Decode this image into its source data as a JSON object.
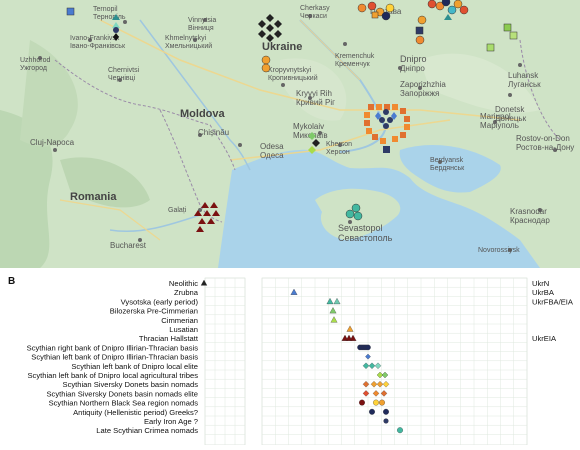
{
  "map": {
    "city_labels": [
      {
        "name": "Ternopil",
        "alt": "Тернопіль"
      },
      {
        "name": "Vinnytsia",
        "alt": "Вінниця"
      },
      {
        "name": "Cherkasy",
        "alt": "Черкаси"
      },
      {
        "name": "Ivano-Frankivsk",
        "alt": "Івано-Франківськ"
      },
      {
        "name": "Khmelnytskyi",
        "alt": "Хмельницький"
      },
      {
        "name": "Ukraine",
        "alt": ""
      },
      {
        "name": "Kremenchuk",
        "alt": "Кременчук"
      },
      {
        "name": "Dnipro",
        "alt": "Дніпро"
      },
      {
        "name": "Luhansk",
        "alt": "Луганськ"
      },
      {
        "name": "Uzhhorod",
        "alt": "Ужгород"
      },
      {
        "name": "Chernivtsi",
        "alt": "Чернівці"
      },
      {
        "name": "Kropyvnytskyi",
        "alt": "Кропивницький"
      },
      {
        "name": "Zaporizhzhia",
        "alt": "Запоріжжя"
      },
      {
        "name": "Donetsk",
        "alt": "Донецьк"
      },
      {
        "name": "Kryvyi Rih",
        "alt": "Кривий Ріг"
      },
      {
        "name": "Moldova",
        "alt": ""
      },
      {
        "name": "Mykolaiv",
        "alt": "Миколаїв"
      },
      {
        "name": "Mariupol",
        "alt": "Маріуполь"
      },
      {
        "name": "Chișinău",
        "alt": ""
      },
      {
        "name": "Odesa",
        "alt": "Одеса"
      },
      {
        "name": "Kherson",
        "alt": "Херсон"
      },
      {
        "name": "Rostov-on-Don",
        "alt": "Ростов-на-Дону"
      },
      {
        "name": "Cluj-Napoca",
        "alt": ""
      },
      {
        "name": "Berdyansk",
        "alt": "Бердянськ"
      },
      {
        "name": "Romania",
        "alt": ""
      },
      {
        "name": "Krasnodar",
        "alt": "Краснодар"
      },
      {
        "name": "Galați",
        "alt": ""
      },
      {
        "name": "Sevastopol",
        "alt": "Севастополь"
      },
      {
        "name": "Bucharest",
        "alt": ""
      },
      {
        "name": "Novorossiysk",
        "alt": "Новороссийск"
      }
    ],
    "poltava_label": "Полтава"
  },
  "panel_b": {
    "letter": "B",
    "groups": [
      "Neolithic",
      "Zrubna",
      "Vysotska (early period)",
      "Bilozerska Pre-Cimmerian",
      "Cimmerian",
      "Lusatian",
      "Thracian Hallstatt",
      "Scythian right bank of Dnipro Illirian-Thracian basis",
      "Scythian left bank of Dnipro Illirian-Thracian basis",
      "Scythian left bank of Dnipro local elite",
      "Scythian left bank of Dnipro local agricultural tribes",
      "Scythian Siversky Donets basin nomads",
      "Scythian Siversky Donets basin nomads elite",
      "Scythian Northern Black Sea region nomads",
      "Antiquity (Hellenistic period) Greeks?",
      "Early Iron Age ?",
      "Late Scythian Crimea nomads"
    ],
    "period_labels": [
      "UkrN",
      "UkrBA",
      "UkrFBA/EIA",
      "",
      "",
      "",
      "UkrEIA",
      "",
      "",
      "",
      "",
      "",
      "",
      "",
      "",
      "",
      ""
    ]
  }
}
